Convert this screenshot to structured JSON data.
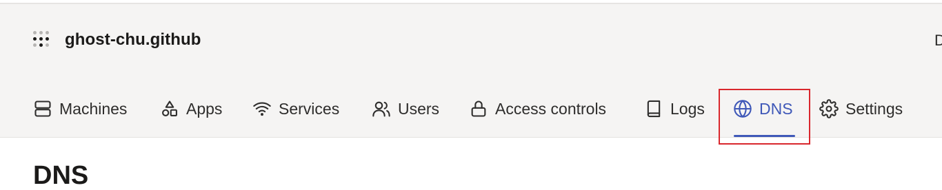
{
  "tailnet": {
    "name": "ghost-chu.github"
  },
  "header_edge_text": "D",
  "nav": {
    "machines": "Machines",
    "apps": "Apps",
    "services": "Services",
    "users": "Users",
    "access_controls": "Access controls",
    "logs": "Logs",
    "dns": "DNS",
    "settings": "Settings",
    "active": "DNS"
  },
  "page": {
    "title": "DNS"
  },
  "colors": {
    "accent": "#3f58b8",
    "highlight": "#d9262c",
    "header_bg": "#f5f4f3"
  },
  "icons": [
    "tailscale-logo-icon",
    "server-icon",
    "apps-shapes-icon",
    "wifi-icon",
    "users-icon",
    "lock-icon",
    "book-icon",
    "globe-icon",
    "gear-icon"
  ]
}
